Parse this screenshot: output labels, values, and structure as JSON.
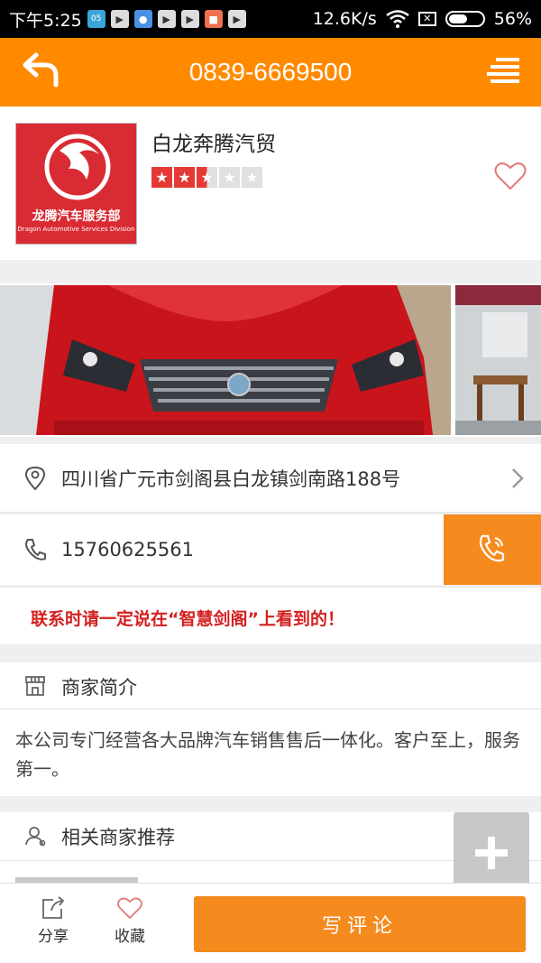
{
  "status_bar": {
    "time": "下午5:25",
    "app_icons": [
      "05",
      "▶",
      "●",
      "▶",
      "▶",
      "■",
      "▶"
    ],
    "network_speed": "12.6K/s",
    "sim_status": "✕",
    "battery": "56%",
    "battery_level": 0.56
  },
  "header": {
    "title": "0839-6669500",
    "back_icon": "back-arrow-icon",
    "menu_icon": "list-menu-icon"
  },
  "shop": {
    "name": "白龙奔腾汽贸",
    "logo_text": "龙腾汽车服务部",
    "logo_subtext": "Dragon Automotive Services Division",
    "rating": 2.5,
    "rating_max": 5
  },
  "address": {
    "text": "四川省广元市剑阁县白龙镇剑南路188号"
  },
  "phone": {
    "text": "15760625561"
  },
  "notice": {
    "text": "联系时请一定说在“智慧剑阁”上看到的！"
  },
  "intro": {
    "title": "商家简介",
    "body": "本公司专门经营各大品牌汽车销售售后一体化。客户至上，服务第一。"
  },
  "related": {
    "title": "相关商家推荐"
  },
  "bottom_bar": {
    "share_label": "分享",
    "favorite_label": "收藏",
    "comment_label": "写评论"
  },
  "colors": {
    "accent": "#ff8a00",
    "call_button": "#f58a1f",
    "notice": "#d42020",
    "star": "#e53935"
  }
}
